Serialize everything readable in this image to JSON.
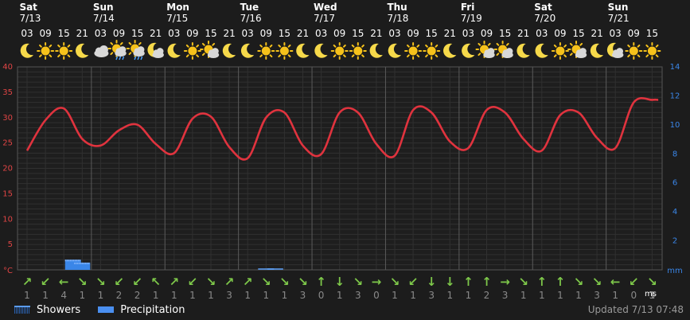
{
  "chart_data": {
    "type": "line",
    "days": [
      {
        "day": "Sat",
        "date": "7/13",
        "hours": [
          "03",
          "09",
          "15",
          "21"
        ]
      },
      {
        "day": "Sun",
        "date": "7/14",
        "hours": [
          "03",
          "09",
          "15",
          "21"
        ]
      },
      {
        "day": "Mon",
        "date": "7/15",
        "hours": [
          "03",
          "09",
          "15",
          "21"
        ]
      },
      {
        "day": "Tue",
        "date": "7/16",
        "hours": [
          "03",
          "09",
          "15",
          "21"
        ]
      },
      {
        "day": "Wed",
        "date": "7/17",
        "hours": [
          "03",
          "09",
          "15",
          "21"
        ]
      },
      {
        "day": "Thu",
        "date": "7/18",
        "hours": [
          "03",
          "09",
          "15",
          "21"
        ]
      },
      {
        "day": "Fri",
        "date": "7/19",
        "hours": [
          "03",
          "09",
          "15",
          "21"
        ]
      },
      {
        "day": "Sat",
        "date": "7/20",
        "hours": [
          "03",
          "09",
          "15",
          "21"
        ]
      },
      {
        "day": "Sun",
        "date": "7/21",
        "hours": [
          "03",
          "09",
          "15"
        ]
      }
    ],
    "weather_icons": [
      "moon-icon",
      "sun-icon",
      "sun-icon",
      "moon-icon",
      "cloudy-icon",
      "sun-cloud-rain-icon",
      "sun-cloud-rain-icon",
      "moon-cloud-icon",
      "moon-icon",
      "sun-icon",
      "sun-cloud-icon",
      "moon-icon",
      "moon-icon",
      "sun-icon",
      "sun-icon",
      "moon-icon",
      "moon-icon",
      "sun-icon",
      "sun-icon",
      "moon-icon",
      "moon-icon",
      "sun-icon",
      "sun-icon",
      "moon-icon",
      "moon-icon",
      "sun-cloud-icon",
      "sun-cloud-icon",
      "moon-icon",
      "moon-icon",
      "sun-icon",
      "sun-cloud-icon",
      "moon-icon",
      "moon-cloud-icon",
      "sun-icon",
      "sun-icon"
    ],
    "temperature": {
      "unit": "°C",
      "x_hours": [
        0,
        6,
        12,
        18,
        24,
        30,
        36,
        42,
        48,
        54,
        60,
        66,
        72,
        78,
        84,
        90,
        96,
        102,
        108,
        114,
        120,
        126,
        132,
        138,
        144,
        150,
        156,
        162,
        168,
        174,
        180,
        186,
        192,
        198,
        204,
        206
      ],
      "values": [
        23.5,
        29.5,
        31.8,
        25.8,
        24.5,
        27.5,
        28.6,
        24.8,
        23.0,
        29.8,
        30.2,
        24.2,
        22.0,
        30.0,
        31.0,
        24.5,
        22.8,
        31.0,
        31.0,
        24.8,
        22.5,
        31.5,
        31.0,
        25.3,
        24.0,
        31.5,
        31.0,
        25.8,
        23.5,
        30.5,
        31.0,
        26.0,
        24.0,
        33.0,
        33.5,
        33.5
      ],
      "ylim": [
        0,
        40
      ],
      "ticks": [
        5,
        10,
        15,
        20,
        25,
        30,
        35,
        40
      ],
      "color": "#e0333e"
    },
    "precipitation": {
      "unit": "mm",
      "ylim": [
        0,
        14
      ],
      "ticks": [
        0,
        2,
        4,
        6,
        8,
        10,
        12,
        14
      ],
      "bars": [
        {
          "hour": 15,
          "value": 0.7
        },
        {
          "hour": 18,
          "value": 0.5
        }
      ],
      "showers": [
        {
          "hour": 78,
          "value": 0.05
        },
        {
          "hour": 81,
          "value": 0.1
        }
      ],
      "color": "#4a8ff0"
    },
    "wind": {
      "unit": "ms",
      "directions": [
        "↗",
        "↙",
        "←",
        "↘",
        "↘",
        "↙",
        "↙",
        "↖",
        "↗",
        "↙",
        "↘",
        "↗",
        "↗",
        "↘",
        "↘",
        "↘",
        "↑",
        "↓",
        "↘",
        "→",
        "↘",
        "↙",
        "↓",
        "↓",
        "↑",
        "↑",
        "→",
        "↘",
        "↑",
        "↑",
        "↘",
        "↘",
        "←",
        "↙",
        "↘"
      ],
      "speeds": [
        "1",
        "1",
        "4",
        "1",
        "1",
        "2",
        "2",
        "1",
        "1",
        "1",
        "1",
        "3",
        "1",
        "1",
        "1",
        "3",
        "0",
        "1",
        "3",
        "0",
        "1",
        "1",
        "3",
        "1",
        "1",
        "2",
        "3",
        "1",
        "1",
        "1",
        "1",
        "3",
        "1",
        "0",
        "1",
        "3"
      ]
    },
    "grid": true,
    "legend_position": "bottom-left"
  },
  "legend": {
    "showers_label": "Showers",
    "precipitation_label": "Precipitation"
  },
  "footer": {
    "updated": "Updated 7/13 07:48"
  },
  "colors": {
    "background": "#1c1c1c",
    "plot_background": "#1e1e1e",
    "grid_minor": "#303030",
    "grid_major": "#5a5a5a",
    "temperature": "#e0333e",
    "temperature_axis": "#e04545",
    "precipitation_axis": "#3a86e8",
    "wind_arrow": "#7ec84a",
    "wind_speed": "#8a8a8a",
    "sun": "#f6c21b",
    "moon": "#f6d94a",
    "cloud": "#d8d8d8"
  }
}
